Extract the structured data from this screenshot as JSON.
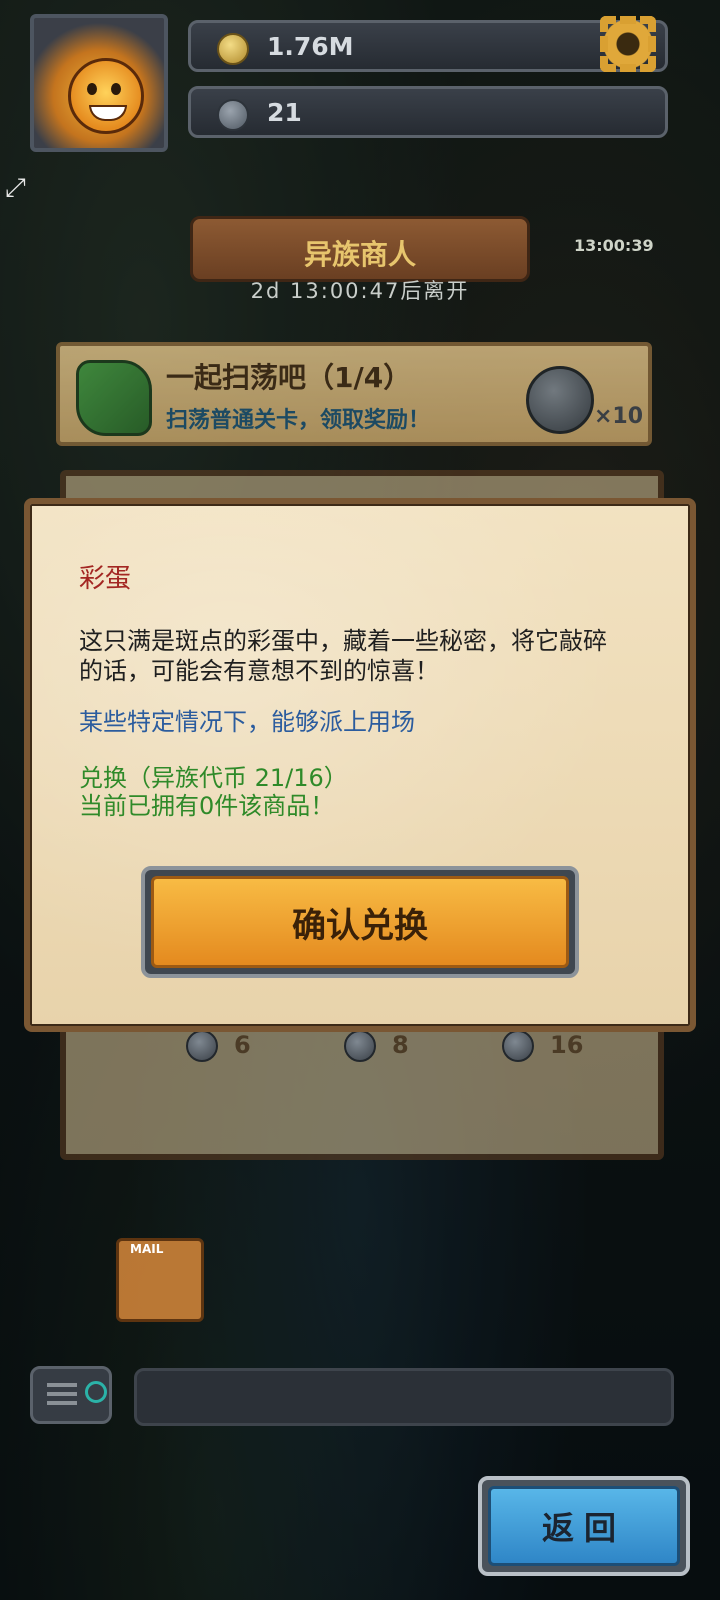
{
  "hud": {
    "gold": "1.76M",
    "tokens": "21",
    "side_timer": "13:00:39"
  },
  "merchant": {
    "title": "异族商人",
    "countdown": "2d 13:00:47后离开"
  },
  "quest": {
    "title": "一起扫荡吧（1/4）",
    "description": "扫荡普通关卡，领取奖励！",
    "reward_count": "×10"
  },
  "shop": {
    "prices": [
      "6",
      "8",
      "16"
    ]
  },
  "dialog": {
    "item_name": "彩蛋",
    "description": "这只满是斑点的彩蛋中，藏着一些秘密，将它敲碎的话，可能会有意想不到的惊喜！",
    "note": "某些特定情况下，能够派上用场",
    "exchange_line": "兑换（异族代币 21/16）",
    "owned_line": "当前已拥有0件该商品！",
    "confirm_label": "确认兑换"
  },
  "bottom": {
    "mail_label": "MAIL",
    "back_label": "返回"
  }
}
